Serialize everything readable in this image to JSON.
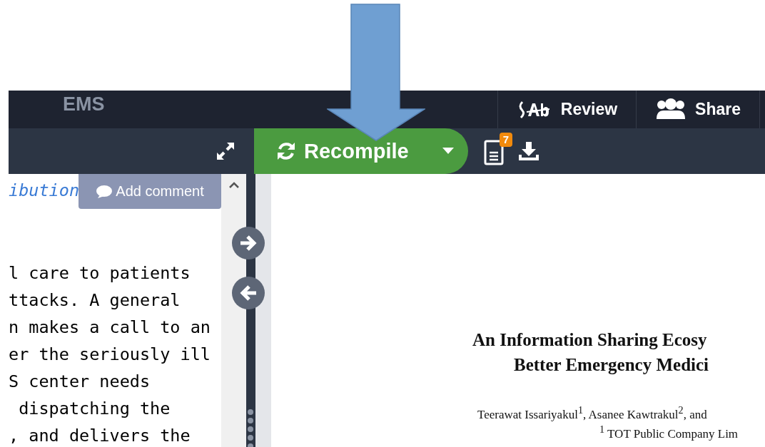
{
  "top_bar": {
    "project_title": "EMS",
    "buttons": [
      {
        "kind": "review",
        "label": "Review"
      },
      {
        "kind": "share",
        "label": "Share"
      }
    ]
  },
  "toolbar": {
    "recompile": {
      "label": "Recompile"
    },
    "logs_badge": "7"
  },
  "editor": {
    "comment_button": "Add comment",
    "first_line": "ibution",
    "lines": [
      "l care to patients",
      "ttacks. A general",
      "n makes a call to an",
      "er the seriously ill",
      "S center needs",
      " dispatching the",
      ", and delivers the"
    ]
  },
  "pdf": {
    "title_lines": [
      "An Information Sharing Ecosy",
      "Better Emergency Medici"
    ],
    "authors": "Teerawat Issariyakul$^{1}$, Asanee Kawtrakul$^{2}$, and",
    "affiliation": "$^{1}$ TOT Public Company Lim"
  }
}
